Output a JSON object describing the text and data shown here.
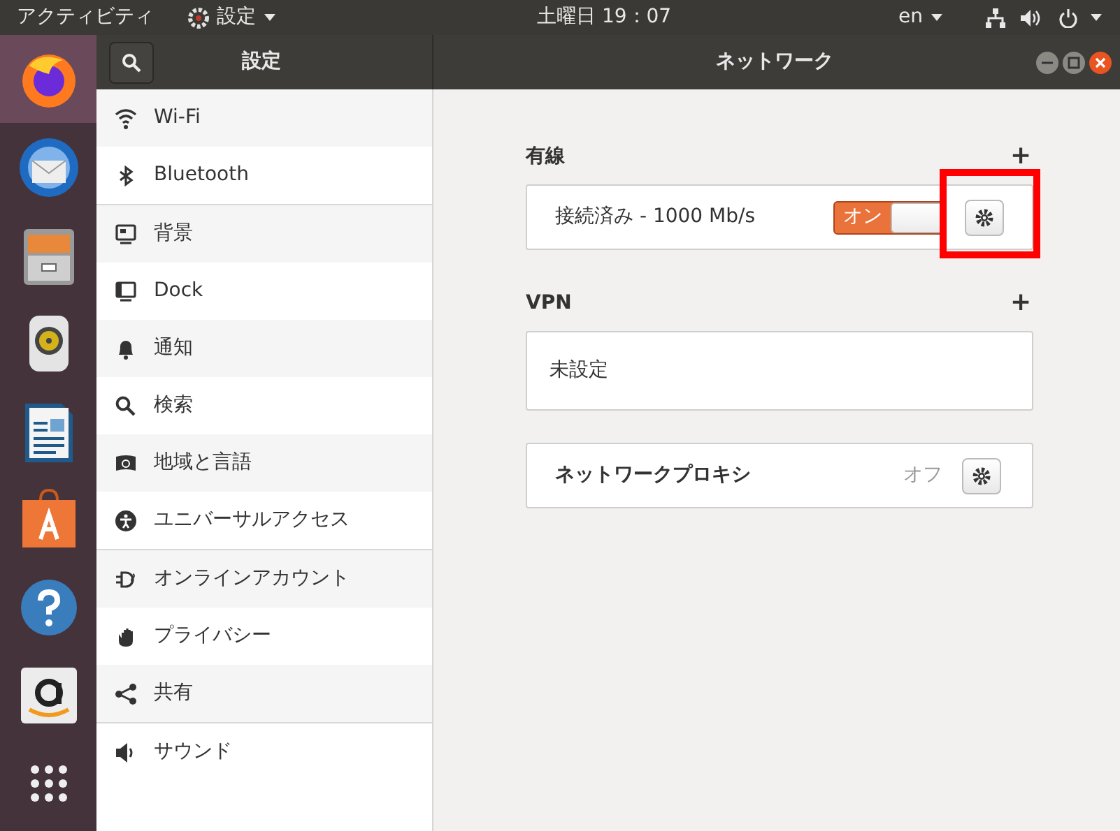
{
  "top_bar": {
    "activities": "アクティビティ",
    "app_menu": "設定",
    "clock": "土曜日 19：07",
    "input_source": "en"
  },
  "dock": [
    {
      "kind": "browser",
      "active": true
    },
    {
      "kind": "mail",
      "active": false
    },
    {
      "kind": "files",
      "active": false
    },
    {
      "kind": "music",
      "active": false
    },
    {
      "kind": "writer",
      "active": false
    },
    {
      "kind": "store",
      "active": false
    },
    {
      "kind": "help",
      "active": false
    },
    {
      "kind": "amazon",
      "active": false
    },
    {
      "kind": "apps",
      "active": false
    }
  ],
  "window": {
    "sidebar_title": "設定",
    "title": "ネットワーク"
  },
  "sidebar": {
    "groups": [
      [
        {
          "label": "Wi-Fi"
        },
        {
          "label": "Bluetooth"
        }
      ],
      [
        {
          "label": "背景"
        },
        {
          "label": "Dock"
        },
        {
          "label": "通知"
        },
        {
          "label": "検索"
        },
        {
          "label": "地域と言語"
        },
        {
          "label": "ユニバーサルアクセス"
        }
      ],
      [
        {
          "label": "オンラインアカウント"
        },
        {
          "label": "プライバシー"
        },
        {
          "label": "共有"
        }
      ],
      [
        {
          "label": "サウンド"
        }
      ]
    ]
  },
  "wired": {
    "heading": "有線",
    "add": "+",
    "connections": [
      {
        "status": "接続済み - 1000 Mb/s",
        "switch_label": "オン",
        "on": true,
        "highlighted": true
      }
    ]
  },
  "vpn": {
    "heading": "VPN",
    "add": "+",
    "empty": "未設定"
  },
  "proxy": {
    "label": "ネットワークプロキシ",
    "status": "オフ"
  }
}
